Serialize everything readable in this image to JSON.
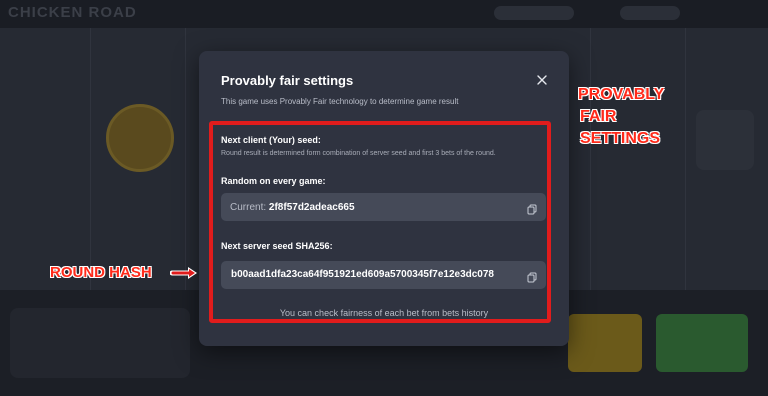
{
  "background": {
    "logo": "CHICKEN ROAD"
  },
  "modal": {
    "title": "Provably fair settings",
    "subtitle": "This game uses Provably Fair technology to determine game result",
    "client": {
      "title": "Next client (Your) seed:",
      "description": "Round result is determined form combination of server seed and first 3 bets of the round.",
      "random_label": "Random on every game:",
      "current_label": "Current:",
      "current_value": "2f8f57d2adeac665"
    },
    "server": {
      "label": "Next server seed SHA256:",
      "hash": "b00aad1dfa23ca64f951921ed609a5700345f7e12e3dc078"
    },
    "footer": "You can check fairness of each bet from bets history"
  },
  "annotations": {
    "provably_fair": [
      "PROVABLY",
      "FAIR",
      "SETTINGS"
    ],
    "round_hash": "ROUND HASH"
  },
  "colors": {
    "annotation_red": "#e11c1c",
    "modal_bg": "#2f3340",
    "field_bg": "#454a58"
  }
}
